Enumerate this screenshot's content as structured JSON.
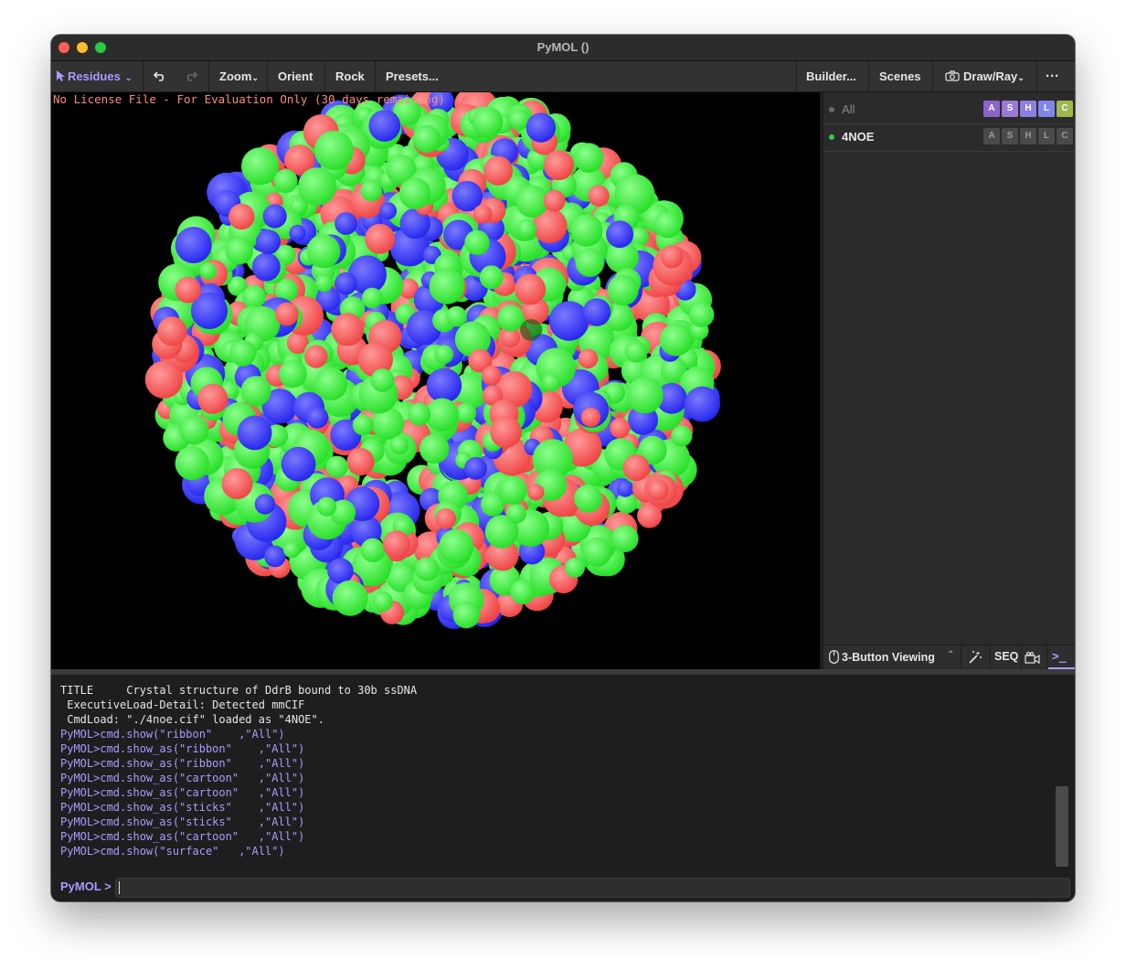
{
  "window": {
    "title": "PyMOL ()"
  },
  "toolbar": {
    "mouse_mode": "Residues",
    "zoom": "Zoom",
    "orient": "Orient",
    "rock": "Rock",
    "presets": "Presets...",
    "builder": "Builder...",
    "scenes": "Scenes",
    "draw_ray": "Draw/Ray",
    "more": "···"
  },
  "viewport": {
    "license_notice": "No License File - For Evaluation Only (30 days remaining)",
    "surface_colors": {
      "carbon": "#22dd22",
      "oxygen": "#ee4040",
      "nitrogen": "#2222ee",
      "background": "#000000"
    }
  },
  "objects_panel": {
    "rows": [
      {
        "name": "All",
        "active": false,
        "buttons": [
          "A",
          "S",
          "H",
          "L",
          "C"
        ]
      },
      {
        "name": "4NOE",
        "active": true,
        "buttons": [
          "A",
          "S",
          "H",
          "L",
          "C"
        ]
      }
    ],
    "button_colors": {
      "A": "#8c63c9",
      "S": "#9a7ad6",
      "H": "#8d7fe0",
      "L": "#7f86e8",
      "C": "#9eb84e"
    }
  },
  "panel_footer": {
    "viewing_mode": "3-Button Viewing",
    "seq": "SEQ",
    "console_icon": ">_"
  },
  "console": {
    "lines": [
      {
        "text": "TITLE     Crystal structure of DdrB bound to 30b ssDNA",
        "kind": "out"
      },
      {
        "text": " ExecutiveLoad-Detail: Detected mmCIF",
        "kind": "out"
      },
      {
        "text": " CmdLoad: \"./4noe.cif\" loaded as \"4NOE\".",
        "kind": "out"
      },
      {
        "text": "PyMOL>cmd.show(\"ribbon\"    ,\"All\")",
        "kind": "cmd"
      },
      {
        "text": "PyMOL>cmd.show_as(\"ribbon\"    ,\"All\")",
        "kind": "cmd"
      },
      {
        "text": "PyMOL>cmd.show_as(\"ribbon\"    ,\"All\")",
        "kind": "cmd"
      },
      {
        "text": "PyMOL>cmd.show_as(\"cartoon\"   ,\"All\")",
        "kind": "cmd"
      },
      {
        "text": "PyMOL>cmd.show_as(\"cartoon\"   ,\"All\")",
        "kind": "cmd"
      },
      {
        "text": "PyMOL>cmd.show_as(\"sticks\"    ,\"All\")",
        "kind": "cmd"
      },
      {
        "text": "PyMOL>cmd.show_as(\"sticks\"    ,\"All\")",
        "kind": "cmd"
      },
      {
        "text": "PyMOL>cmd.show_as(\"cartoon\"   ,\"All\")",
        "kind": "cmd"
      },
      {
        "text": "PyMOL>cmd.show(\"surface\"   ,\"All\")",
        "kind": "cmd"
      }
    ],
    "colors": {
      "out": "#e6e6e6",
      "cmd": "#a89cff"
    }
  },
  "command_line": {
    "prompt": "PyMOL >",
    "value": ""
  }
}
